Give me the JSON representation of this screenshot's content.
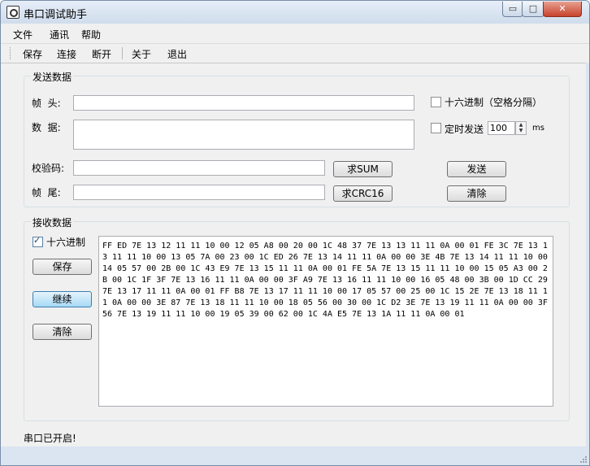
{
  "window": {
    "title": "串口调试助手",
    "min": "▭",
    "max": "□",
    "close": "✕"
  },
  "menu": {
    "items": [
      "文件",
      "通讯",
      "帮助"
    ]
  },
  "toolbar": {
    "items": [
      "保存",
      "连接",
      "断开",
      "关于",
      "退出"
    ]
  },
  "send": {
    "group_label": "发送数据",
    "frame_head_label": "帧  头:",
    "data_label": "数  据:",
    "checksum_label": "校验码:",
    "frame_tail_label": "帧  尾:",
    "hex_label": "十六进制（空格分隔）",
    "hex_checked": false,
    "timer_label": "定时发送",
    "timer_checked": false,
    "timer_value": "100",
    "timer_unit": "ms",
    "sum_button": "求SUM",
    "crc_button": "求CRC16",
    "send_button": "发送",
    "clear_button": "清除"
  },
  "receive": {
    "group_label": "接收数据",
    "hex_label": "十六进制",
    "hex_checked": true,
    "save_button": "保存",
    "continue_button": "继续",
    "clear_button": "清除",
    "content": "FF ED 7E 13 12 11 11 10 00 12 05 A8 00 20 00 1C 48 37 7E 13 13 11 11 0A 00 01 FE 3C 7E 13 13 11 11 10 00 13 05 7A 00 23 00 1C ED 26 7E 13 14 11 11 0A 00 00 3E 4B 7E 13 14 11 11 10 00 14 05 57 00 2B 00 1C 43 E9 7E 13 15 11 11 0A 00 01 FE 5A 7E 13 15 11 11 10 00 15 05 A3 00 2B 00 1C 1F 3F 7E 13 16 11 11 0A 00 00 3F A9 7E 13 16 11 11 10 00 16 05 48 00 3B 00 1D CC 29 7E 13 17 11 11 0A 00 01 FF B8 7E 13 17 11 11 10 00 17 05 57 00 25 00 1C 15 2E 7E 13 18 11 11 0A 00 00 3E 87 7E 13 18 11 11 10 00 18 05 56 00 30 00 1C D2 3E 7E 13 19 11 11 0A 00 00 3F 56 7E 13 19 11 11 10 00 19 05 39 00 62 00 1C 4A E5 7E 13 1A 11 11 0A 00 01"
  },
  "status": {
    "text": "串口已开启!"
  }
}
